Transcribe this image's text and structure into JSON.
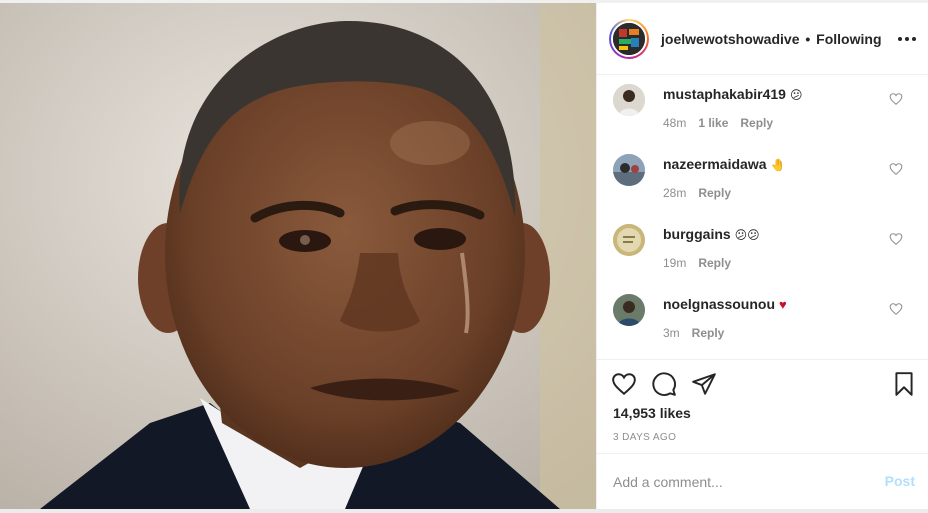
{
  "post": {
    "author": "joelwewotshowadive",
    "separator": "•",
    "follow_status": "Following"
  },
  "comments": [
    {
      "username": "mustaphakabir419",
      "emoji": "😕",
      "time": "48m",
      "likes": "1 like",
      "reply": "Reply"
    },
    {
      "username": "nazeermaidawa",
      "emoji": "🤚",
      "time": "28m",
      "reply": "Reply"
    },
    {
      "username": "burggains",
      "emoji": "😕😕",
      "time": "19m",
      "reply": "Reply"
    },
    {
      "username": "noelgnassounou",
      "emoji": "♥",
      "time": "3m",
      "reply": "Reply"
    }
  ],
  "actions": {
    "likes": "14,953 likes",
    "date": "3 DAYS AGO"
  },
  "comment_box": {
    "placeholder": "Add a comment...",
    "post_label": "Post"
  },
  "icons": {
    "like": "heart-icon",
    "comment": "comment-bubble-icon",
    "share": "paper-plane-icon",
    "save": "bookmark-icon",
    "more": "more-options-icon"
  },
  "colors": {
    "post_button_disabled": "#b2dffc",
    "muted_text": "#8e8e8e",
    "primary_text": "#262626",
    "heart_emoji": "#c8102e"
  }
}
